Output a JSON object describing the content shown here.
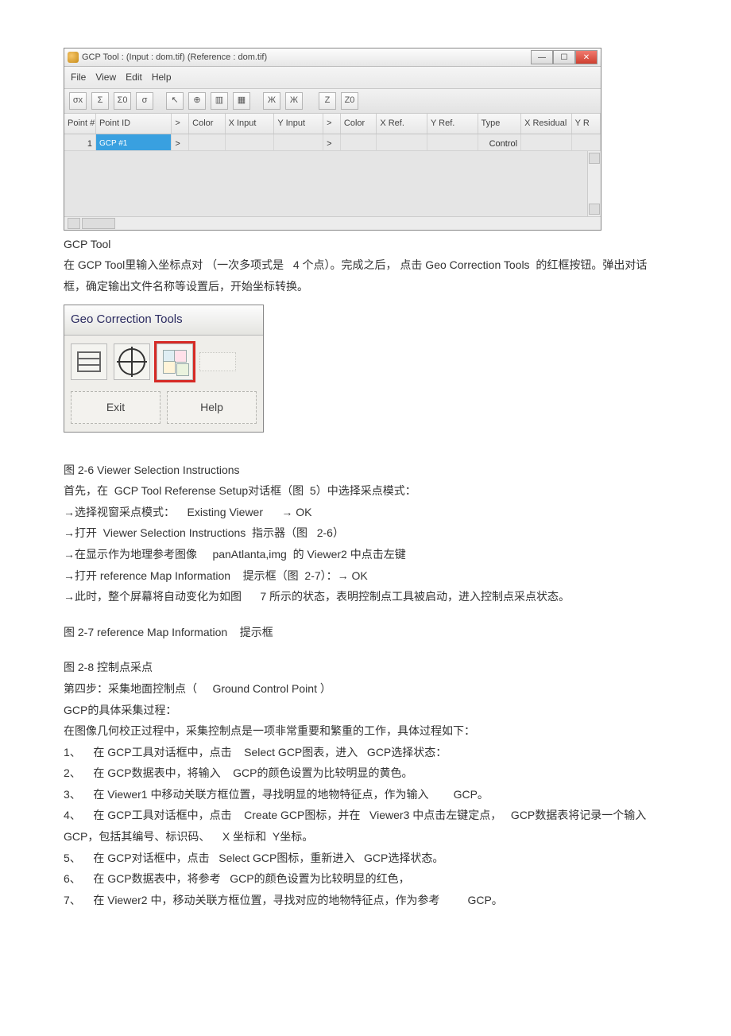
{
  "gcp_window": {
    "title": "GCP Tool : (Input : dom.tif) (Reference : dom.tif)",
    "menu": {
      "file": "File",
      "view": "View",
      "edit": "Edit",
      "help": "Help"
    },
    "toolbar_icons": [
      "σx",
      "Σ",
      "Σ0",
      "σ",
      "↖",
      "⊕",
      "▥",
      "▦",
      "Ж",
      "Ж",
      "Z",
      "Z0"
    ],
    "columns": {
      "point_no": "Point #",
      "point_id": "Point ID",
      "gt": ">",
      "color": "Color",
      "x_input": "X Input",
      "y_input": "Y Input",
      "gt2": ">",
      "color2": "Color",
      "x_ref": "X Ref.",
      "y_ref": "Y Ref.",
      "type": "Type",
      "x_resid": "X Residual",
      "y_resid": "Y R"
    },
    "row1": {
      "point_no": "1",
      "point_id": "GCP #1",
      "gt": ">",
      "gt2": ">",
      "type": "Control"
    }
  },
  "para1_label": "GCP Tool",
  "para1": "在 GCP Tool里输入坐标点对 （一次多项式是   4 个点）。完成之后， 点击 Geo Correction Tools  的红框按钮。弹出对话框，确定输出文件名称等设置后，开始坐标转换。",
  "geo_panel": {
    "title": "Geo Correction Tools",
    "small_label": "",
    "exit": "Exit",
    "help": "Help"
  },
  "fig26": "图 2-6 Viewer Selection Instructions",
  "line2": "首先，在  GCP Tool Referense Setup对话框（图  5）中选择采点模式：",
  "line3": "→选择视窗采点模式：    Existing Viewer      → OK",
  "line4": "→打开  Viewer Selection Instructions  指示器（图   2-6）",
  "line5": "→在显示作为地理参考图像     panAtlanta,img  的 Viewer2 中点击左键",
  "line6": "→打开 reference Map Information    提示框（图  2-7）：→ OK",
  "line7": "→此时，整个屏幕将自动变化为如图      7 所示的状态，表明控制点工具被启动，进入控制点采点状态。",
  "fig27": "图 2-7 reference Map Information    提示框",
  "fig28": "图 2-8 控制点采点",
  "step4": "第四步：采集地面控制点（     Ground Control Point ）",
  "gcp_proc_title": "GCP的具体采集过程：",
  "gcp_proc_intro": "在图像几何校正过程中，采集控制点是一项非常重要和繁重的工作，具体过程如下：",
  "steps": {
    "s1": "1、    在 GCP工具对话框中，点击    Select GCP图表，进入   GCP选择状态：",
    "s2": "2、    在 GCP数据表中，将输入    GCP的颜色设置为比较明显的黄色。",
    "s3": "3、    在 Viewer1 中移动关联方框位置，寻找明显的地物特征点，作为输入        GCP。",
    "s4": "4、    在 GCP工具对话框中，点击    Create GCP图标，并在   Viewer3 中点击左键定点，   GCP数据表将记录一个输入    GCP，包括其编号、标识码、    X 坐标和  Y坐标。",
    "s5": "5、    在 GCP对话框中，点击   Select GCP图标，重新进入   GCP选择状态。",
    "s6": "6、    在 GCP数据表中，将参考   GCP的颜色设置为比较明显的红色，",
    "s7": "7、    在 Viewer2 中，移动关联方框位置，寻找对应的地物特征点，作为参考         GCP。"
  }
}
